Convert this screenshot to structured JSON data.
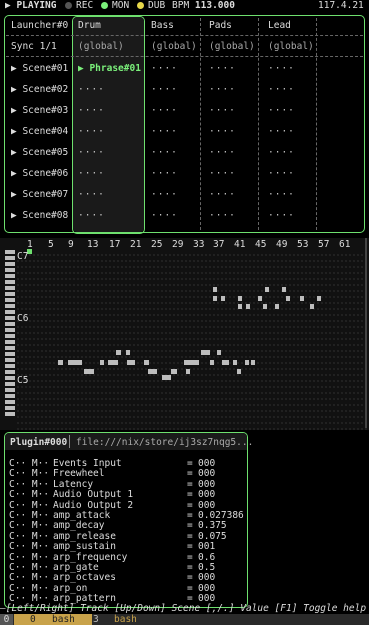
{
  "status": {
    "state": "PLAYING",
    "rec": "REC",
    "mon": "MON",
    "dub": "DUB",
    "bpm_label": "BPM",
    "bpm": "113.000",
    "version": "117.4.21",
    "colors": {
      "rec": "#555555",
      "mon": "#7bf07b",
      "dub": "#e8d84a",
      "accent": "#6ee06e"
    }
  },
  "launcher": {
    "title": "Launcher#0",
    "sync": "Sync 1/1",
    "tracks": [
      "Drum",
      "Bass",
      "Pads",
      "Lead"
    ],
    "global": "(global)",
    "scenes": [
      "Scene#01",
      "Scene#02",
      "Scene#03",
      "Scene#04",
      "Scene#05",
      "Scene#06",
      "Scene#07",
      "Scene#08"
    ],
    "active_clip": "Phrase#01",
    "empty_clip": "····"
  },
  "roll": {
    "bar_labels": [
      "1",
      "5",
      "9",
      "13",
      "17",
      "21",
      "25",
      "29",
      "33",
      "37",
      "41",
      "45",
      "49",
      "53",
      "57",
      "61"
    ],
    "octave_labels": [
      "C7",
      "C6",
      "C5"
    ]
  },
  "plugin": {
    "title": "Plugin#000",
    "path": "file:///nix/store/ij3sz7nqg5...",
    "prefix": "C·· M··",
    "params": [
      {
        "name": "Events Input",
        "value": "000"
      },
      {
        "name": "Freewheel",
        "value": "000"
      },
      {
        "name": "Latency",
        "value": "000"
      },
      {
        "name": "Audio Output 1",
        "value": "000"
      },
      {
        "name": "Audio Output 2",
        "value": "000"
      },
      {
        "name": "amp_attack",
        "value": "0.027386"
      },
      {
        "name": "amp_decay",
        "value": "0.375"
      },
      {
        "name": "amp_release",
        "value": "0.075"
      },
      {
        "name": "amp_sustain",
        "value": "001"
      },
      {
        "name": "arp_frequency",
        "value": "0.6"
      },
      {
        "name": "arp_gate",
        "value": "0.5"
      },
      {
        "name": "arp_octaves",
        "value": "000"
      },
      {
        "name": "arp_on",
        "value": "000"
      },
      {
        "name": "arp_pattern",
        "value": "000"
      }
    ]
  },
  "help": "—[Left/Right] Track  [Up/Down] Scene  [,/.] Value  [F1] Toggle help",
  "tmux": {
    "session": "0",
    "w0_index": "0",
    "w0_name": "bash",
    "w1_index": "3",
    "w1_name": "bash"
  }
}
